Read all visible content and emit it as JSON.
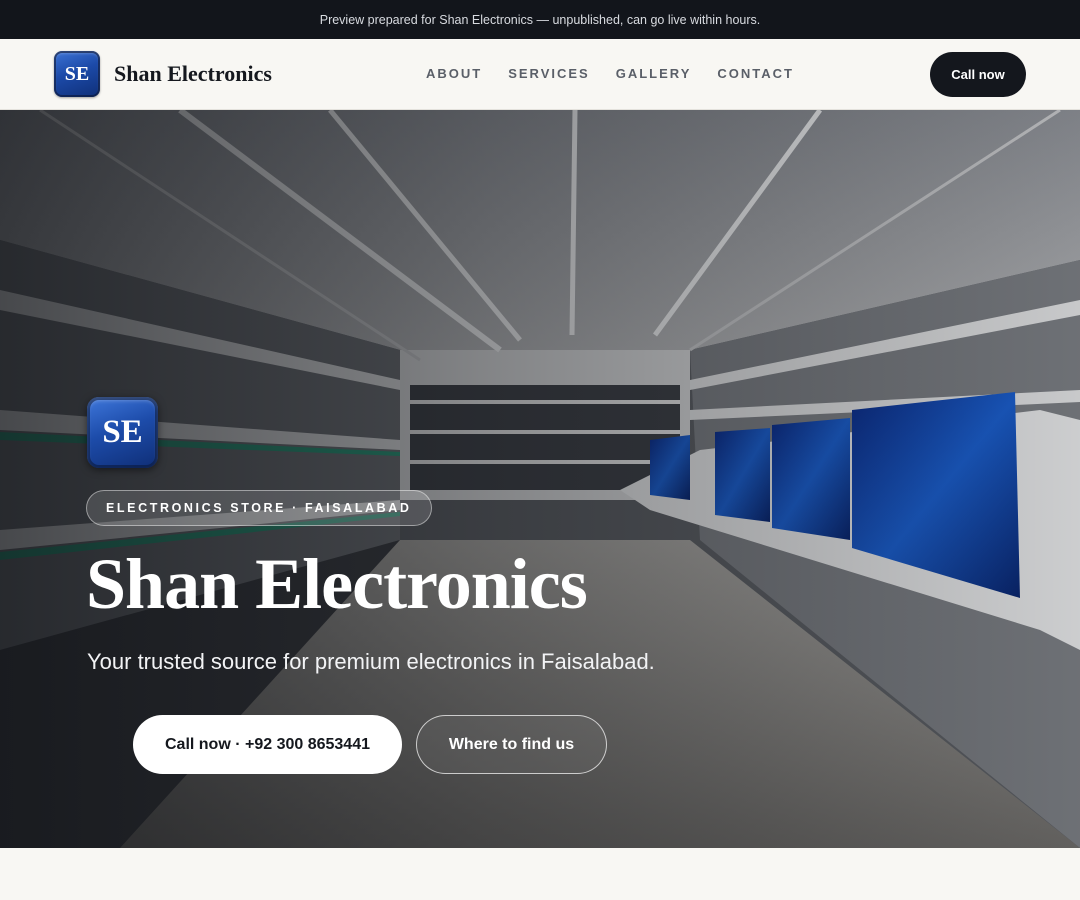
{
  "announcement": {
    "text": "Preview prepared for Shan Electronics — unpublished, can go live within hours."
  },
  "header": {
    "logo_monogram": "SE",
    "brand_name": "Shan Electronics",
    "nav": [
      {
        "label": "ABOUT"
      },
      {
        "label": "SERVICES"
      },
      {
        "label": "GALLERY"
      },
      {
        "label": "CONTACT"
      }
    ],
    "cta_label": "Call now"
  },
  "hero": {
    "logo_monogram": "SE",
    "eyebrow": "ELECTRONICS STORE · FAISALABAD",
    "title": "Shan Electronics",
    "subtitle": "Your trusted source for premium electronics in Faisalabad.",
    "primary_button": "Call now · +92 300 8653441",
    "secondary_button": "Where to find us"
  },
  "colors": {
    "topbar_bg": "#12151b",
    "page_bg": "#f8f7f3",
    "accent_dark": "#14171d",
    "logo_blue": "#1c4aa8"
  }
}
